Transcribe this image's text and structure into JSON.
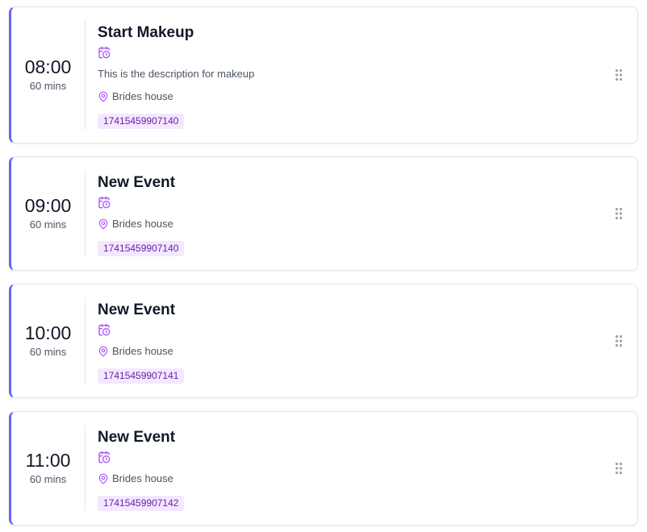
{
  "events": [
    {
      "time": "08:00",
      "duration": "60 mins",
      "title": "Start Makeup",
      "description": "This is the description for makeup",
      "location": "Brides house",
      "id_badge": "17415459907140"
    },
    {
      "time": "09:00",
      "duration": "60 mins",
      "title": "New Event",
      "description": "",
      "location": "Brides house",
      "id_badge": "17415459907140"
    },
    {
      "time": "10:00",
      "duration": "60 mins",
      "title": "New Event",
      "description": "",
      "location": "Brides house",
      "id_badge": "17415459907141"
    },
    {
      "time": "11:00",
      "duration": "60 mins",
      "title": "New Event",
      "description": "",
      "location": "Brides house",
      "id_badge": "17415459907142"
    }
  ],
  "icons": {
    "calendar": "calendar-clock-icon",
    "location": "map-pin-icon",
    "drag": "grip-vertical-icon"
  },
  "colors": {
    "accent_border": "#6366f1",
    "icon_purple": "#a855f7",
    "badge_bg": "#f3e8ff",
    "badge_text": "#6b21a8"
  }
}
